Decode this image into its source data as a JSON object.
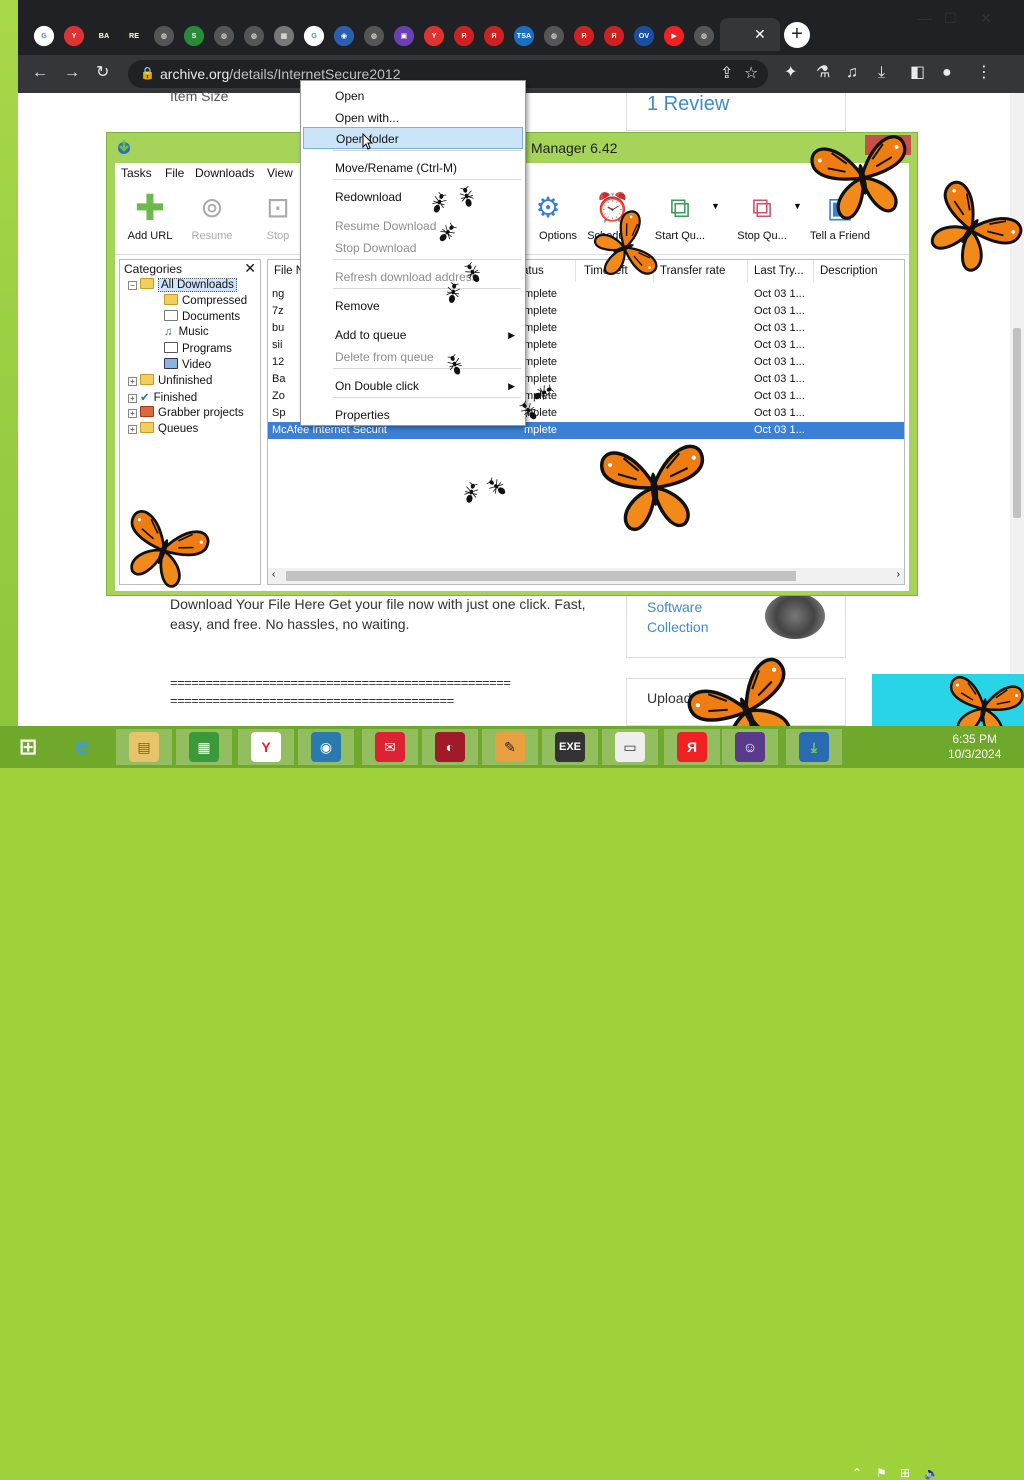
{
  "browser": {
    "tabs": [
      "G",
      "Y",
      "BA",
      "RE",
      "◍",
      "S",
      "◍",
      "◍",
      "▦",
      "G",
      "◉",
      "◍",
      "▣",
      "Y",
      "Я",
      "Я",
      "TSA",
      "◍",
      "Я",
      "Я",
      "OV",
      "▶",
      "◍"
    ],
    "url_domain": "archive.org",
    "url_path": "/details/InternetSecure2012",
    "new_tab": "+",
    "close_tab": "✕"
  },
  "page": {
    "item_size_label": "Item Size",
    "reviews": "1 Review",
    "download_text": "Download Your File Here Get your file now with just one click. Fast, easy, and free. No hassles, no waiting.",
    "eq_line_1": "================================================",
    "eq_line_2": "========================================",
    "software_collection": "Software Collection",
    "uploaded_by": "Uploaded by"
  },
  "idm": {
    "title": "Manager 6.42",
    "menu": [
      "Tasks",
      "File",
      "Downloads",
      "View"
    ],
    "toolbar": [
      {
        "label": "Add URL",
        "icon": "plus-icon",
        "enabled": true
      },
      {
        "label": "Resume",
        "icon": "resume-icon",
        "enabled": false
      },
      {
        "label": "Stop",
        "icon": "stop-icon",
        "enabled": false
      },
      {
        "label": "Options",
        "icon": "gear-icon",
        "enabled": true
      },
      {
        "label": "Scheduler",
        "icon": "clock-icon",
        "enabled": true
      },
      {
        "label": "Start Qu...",
        "icon": "start-queue-icon",
        "enabled": true
      },
      {
        "label": "Stop Qu...",
        "icon": "stop-queue-icon",
        "enabled": true
      },
      {
        "label": "Tell a Friend",
        "icon": "friend-icon",
        "enabled": true
      }
    ],
    "categories_header": "Categories",
    "categories": {
      "all": "All Downloads",
      "sub": [
        "Compressed",
        "Documents",
        "Music",
        "Programs",
        "Video"
      ],
      "unfinished": "Unfinished",
      "finished": "Finished",
      "grabber": "Grabber projects",
      "queues": "Queues"
    },
    "columns": [
      "File N",
      "atus",
      "Time left",
      "Transfer rate",
      "Last Try...",
      "Description"
    ],
    "rows": [
      {
        "name": "ng",
        "status": "mplete",
        "last": "Oct 03 1..."
      },
      {
        "name": "7z",
        "status": "mplete",
        "last": "Oct 03 1..."
      },
      {
        "name": "bu",
        "status": "mplete",
        "last": "Oct 03 1..."
      },
      {
        "name": "sii",
        "status": "mplete",
        "last": "Oct 03 1..."
      },
      {
        "name": "12",
        "status": "mplete",
        "last": "Oct 03 1..."
      },
      {
        "name": "Ba",
        "status": "mplete",
        "last": "Oct 03 1..."
      },
      {
        "name": "Zo",
        "status": "mplete",
        "last": "Oct 03 1..."
      },
      {
        "name": "Sp",
        "status": "mplete",
        "last": "Oct 03 1..."
      },
      {
        "name": "McAfee Internet Securit",
        "status": "mplete",
        "last": "Oct 03 1..."
      }
    ]
  },
  "context_menu": {
    "items": [
      {
        "label": "Open",
        "enabled": true
      },
      {
        "label": "Open with...",
        "enabled": true
      },
      {
        "label": "Open folder",
        "enabled": true,
        "highlighted": true
      },
      {
        "label": "Move/Rename (Ctrl-M)",
        "enabled": true
      },
      {
        "label": "Redownload",
        "enabled": true
      },
      {
        "label": "Resume Download",
        "enabled": false
      },
      {
        "label": "Stop Download",
        "enabled": false
      },
      {
        "label": "Refresh download address",
        "enabled": false
      },
      {
        "label": "Remove",
        "enabled": true
      },
      {
        "label": "Add to queue",
        "enabled": true,
        "submenu": true
      },
      {
        "label": "Delete from queue",
        "enabled": false
      },
      {
        "label": "On Double click",
        "enabled": true,
        "submenu": true
      },
      {
        "label": "Properties",
        "enabled": true
      }
    ]
  },
  "taskbar": {
    "apps": [
      "start-icon",
      "ie-icon",
      "explorer-icon",
      "store-icon",
      "yandex-icon",
      "chrome-icon",
      "gift-icon",
      "media-icon",
      "tool-icon",
      "exe-icon",
      "window-icon",
      "yandex-red-icon",
      "monkey-icon",
      "idm-icon"
    ],
    "exe_label": "EXE",
    "time": "6:35 PM",
    "date": "10/3/2024"
  },
  "colors": {
    "desktop": "#9fd23a",
    "taskbar": "#6fa82a",
    "chrome_dark": "#202124",
    "idm_frame": "#a6d45a",
    "selection": "#3b7fd6",
    "menu_highlight": "#cce4f7"
  }
}
